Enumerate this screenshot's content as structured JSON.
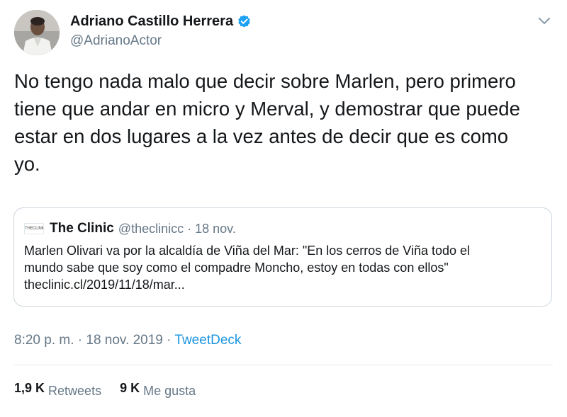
{
  "author": {
    "display_name": "Adriano Castillo Herrera",
    "handle": "@AdrianoActor",
    "verified": true,
    "verified_color": "#1da1f2"
  },
  "menu_icon": "chevron-down-icon",
  "tweet": {
    "text_lines": [
      "No tengo nada malo que decir sobre Marlen, pero primero",
      "tiene que andar en micro y Merval, y demostrar que puede",
      "estar en dos lugares a la vez antes de decir que es como",
      "yo."
    ]
  },
  "quoted_tweet": {
    "avatar_text": "THECLINIC",
    "display_name": "The Clinic",
    "handle": "@theclinicc",
    "separator": "·",
    "date": "18 nov.",
    "text_lines": [
      "Marlen Olivari va por la alcaldía de Viña del Mar: \"En los cerros de Viña todo el",
      "mundo sabe que soy como el compadre Moncho, estoy en todas con ellos\"",
      "theclinic.cl/2019/11/18/mar..."
    ]
  },
  "meta": {
    "time": "8:20 p. m.",
    "separator": "·",
    "date": "18 nov. 2019",
    "source": "TweetDeck",
    "link_color": "#1b95e0"
  },
  "stats": {
    "retweets_count": "1,9 K",
    "retweets_label": "Retweets",
    "likes_count": "9 K",
    "likes_label": "Me gusta"
  }
}
